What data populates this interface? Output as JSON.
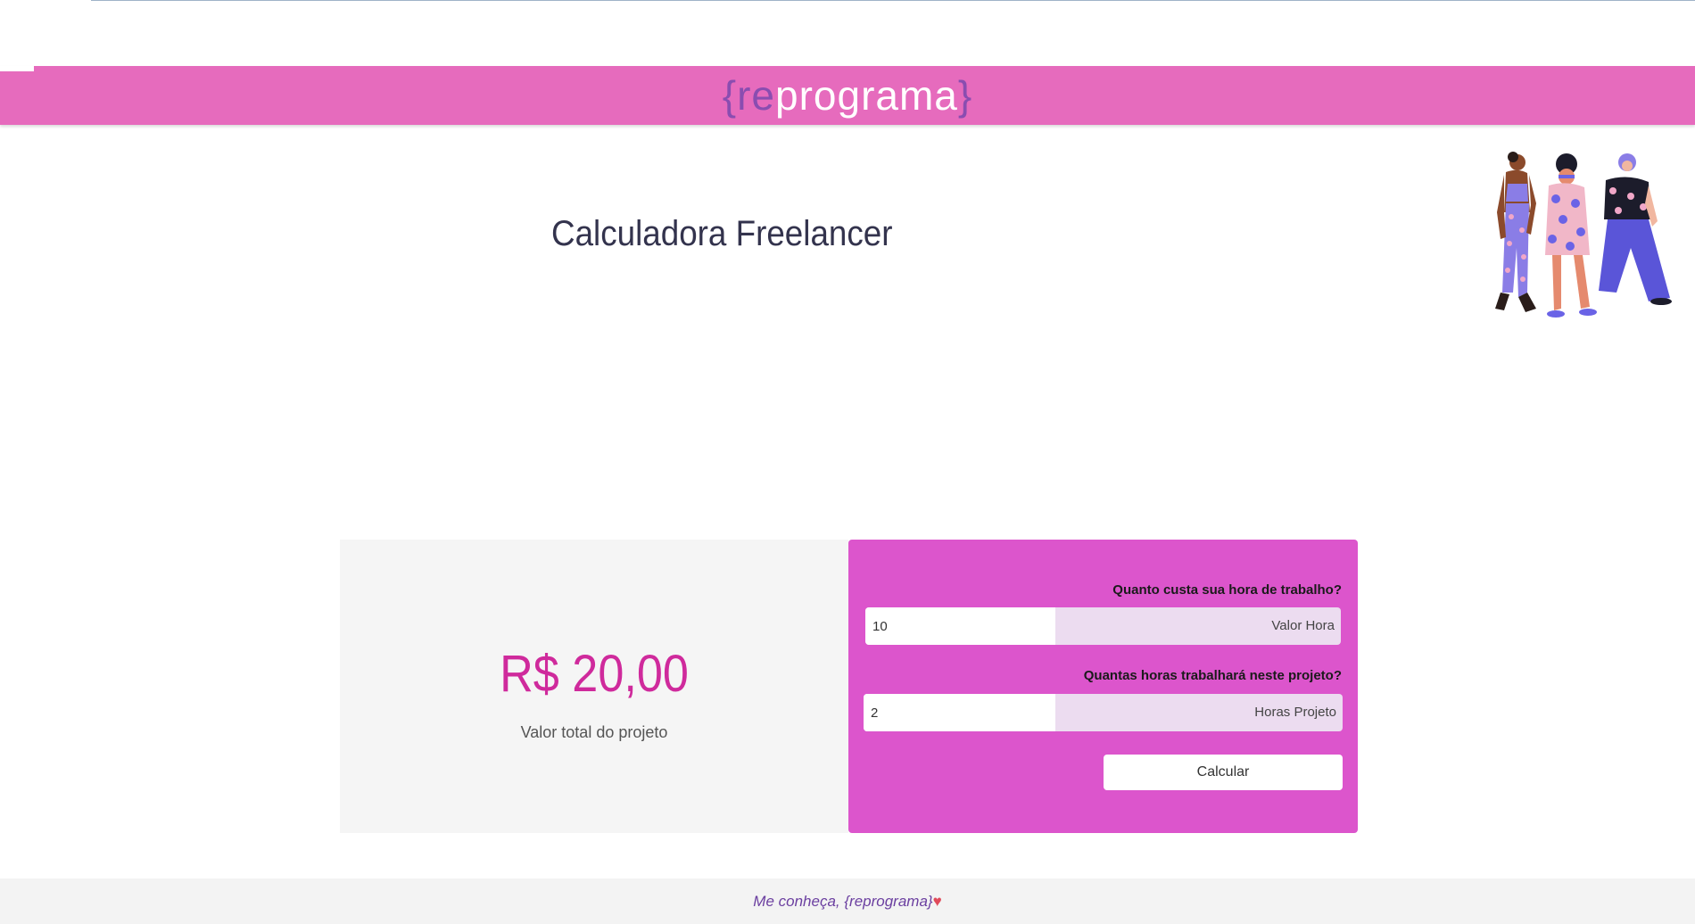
{
  "header": {
    "logo_open_brace": "{",
    "logo_re": "re",
    "logo_rest": "programa",
    "logo_close_brace": "}",
    "background_color": "#e66bbd"
  },
  "page": {
    "title": "Calculadora Freelancer"
  },
  "result": {
    "amount": "R$ 20,00",
    "label": "Valor total do projeto",
    "amount_color": "#cf2a9c"
  },
  "form": {
    "background_color": "#dc55cc",
    "hour_question": "Quanto custa sua hora de trabalho?",
    "hour_value": "10",
    "hour_suffix": "Valor Hora",
    "hours_question": "Quantas horas trabalhará neste projeto?",
    "hours_value": "2",
    "hours_suffix": "Horas Projeto",
    "calculate_label": "Calcular"
  },
  "footer": {
    "link_text": "Me conheça, {reprograma}",
    "heart": "♥"
  }
}
